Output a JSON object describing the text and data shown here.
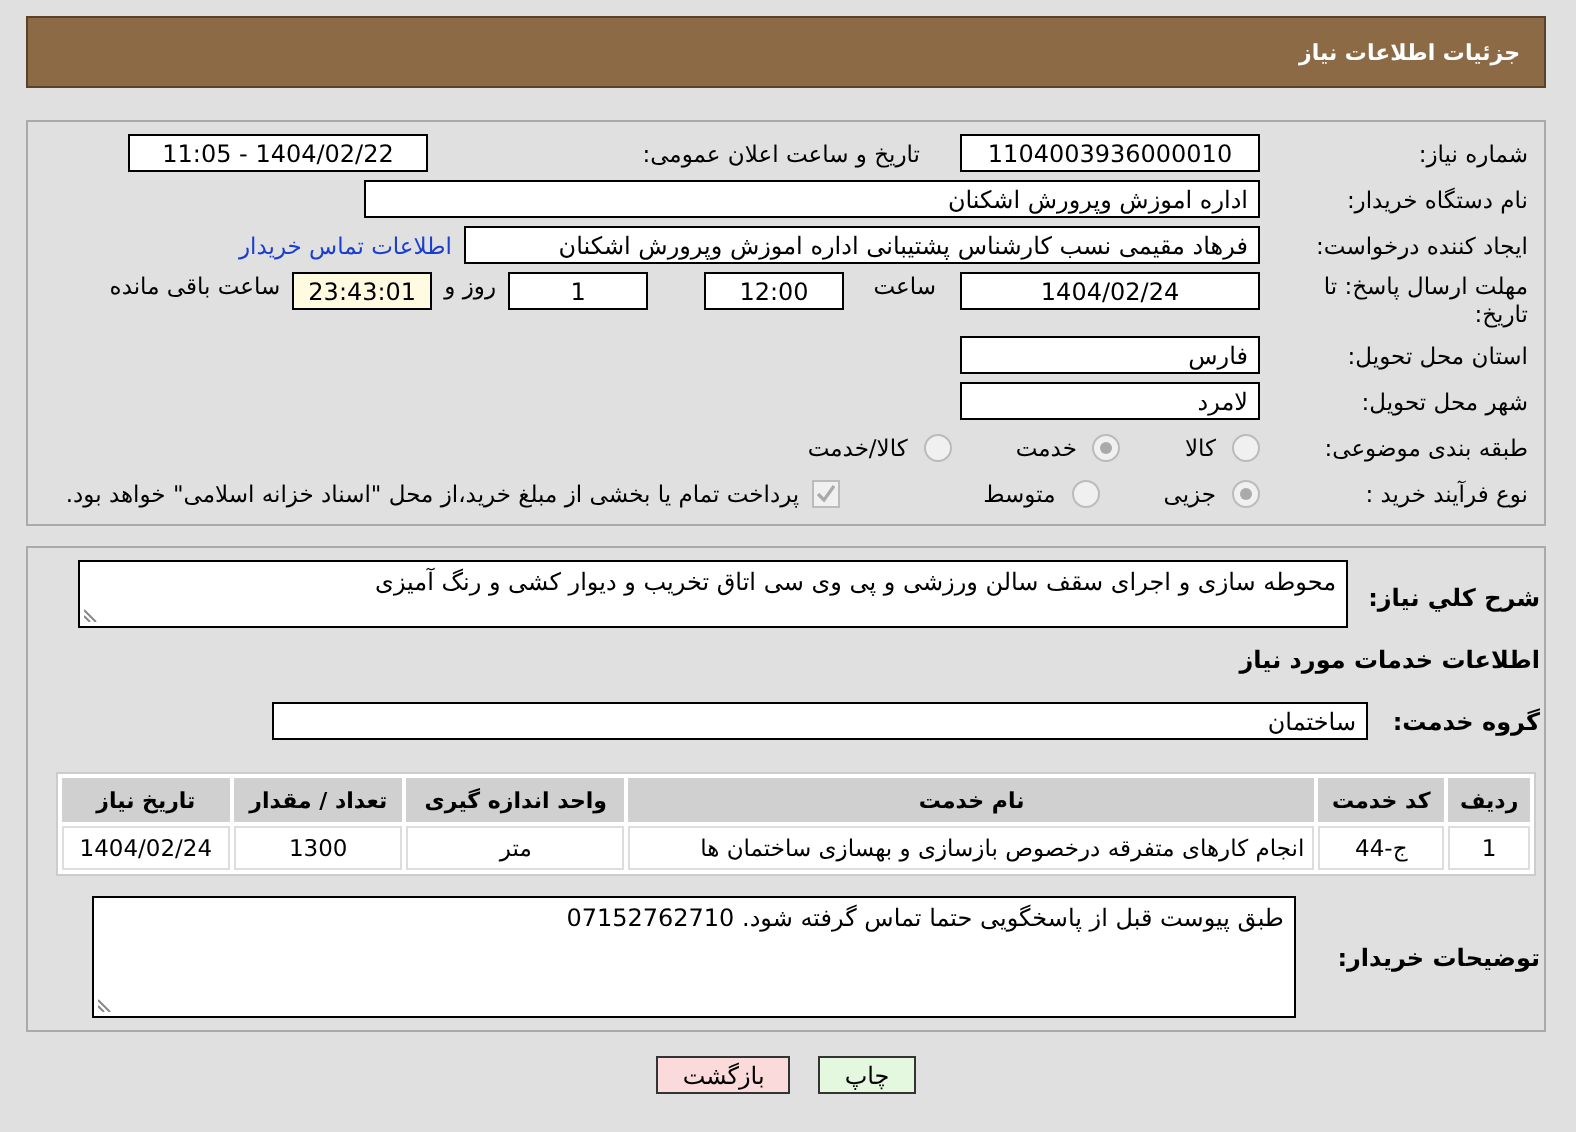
{
  "header": {
    "title": "جزئیات اطلاعات نیاز"
  },
  "details": {
    "need_number": {
      "label": "شماره نیاز:",
      "value": "1104003936000010"
    },
    "announce": {
      "label": "تاریخ و ساعت اعلان عمومی:",
      "value": "1404/02/22 - 11:05"
    },
    "buyer_org": {
      "label": "نام دستگاه خریدار:",
      "value": "اداره اموزش وپرورش اشکنان"
    },
    "creator": {
      "label": "ایجاد کننده درخواست:",
      "value": "فرهاد مقیمی نسب کارشناس پشتیبانی اداره اموزش وپرورش اشکنان",
      "link": "اطلاعات تماس خریدار"
    },
    "deadline": {
      "label": "مهلت ارسال پاسخ: تا تاریخ:",
      "date": "1404/02/24",
      "time_label": "ساعت",
      "time": "12:00",
      "days": "1",
      "days_label": "روز و",
      "remaining": "23:43:01",
      "remaining_label": "ساعت باقی مانده"
    },
    "province": {
      "label": "استان محل تحویل:",
      "value": "فارس"
    },
    "city": {
      "label": "شهر محل تحویل:",
      "value": "لامرد"
    },
    "category": {
      "label": "طبقه بندی موضوعی:",
      "options": [
        {
          "label": "کالا",
          "selected": false
        },
        {
          "label": "خدمت",
          "selected": true
        },
        {
          "label": "کالا/خدمت",
          "selected": false
        }
      ]
    },
    "process": {
      "label": "نوع فرآیند خرید :",
      "options": [
        {
          "label": "جزیی",
          "selected": true
        },
        {
          "label": "متوسط",
          "selected": false
        }
      ],
      "payment_checked": true,
      "payment_text": "پرداخت تمام یا بخشی از مبلغ خرید،از محل \"اسناد خزانه اسلامی\" خواهد بود."
    }
  },
  "description": {
    "label": "شرح کلي نیاز:",
    "value": "محوطه سازی و اجرای سقف سالن ورزشی و پی وی سی اتاق تخریب و دیوار کشی و رنگ آمیزی"
  },
  "services_heading": "اطلاعات خدمات مورد نیاز",
  "service_group": {
    "label": "گروه خدمت:",
    "value": "ساختمان"
  },
  "table": {
    "columns": [
      "ردیف",
      "کد خدمت",
      "نام خدمت",
      "واحد اندازه گیری",
      "تعداد / مقدار",
      "تاریخ نیاز"
    ],
    "rows": [
      [
        "1",
        "ج-44",
        "انجام کارهای متفرقه درخصوص بازسازی و بهسازی ساختمان ها",
        "متر",
        "1300",
        "1404/02/24"
      ]
    ]
  },
  "buyer_notes": {
    "label": "توضیحات خریدار:",
    "value": "طبق پیوست قبل از پاسخگویی حتما تماس گرفته شود. 07152762710"
  },
  "buttons": [
    {
      "label": "چاپ",
      "kind": "print"
    },
    {
      "label": "بازگشت",
      "kind": "back"
    }
  ]
}
